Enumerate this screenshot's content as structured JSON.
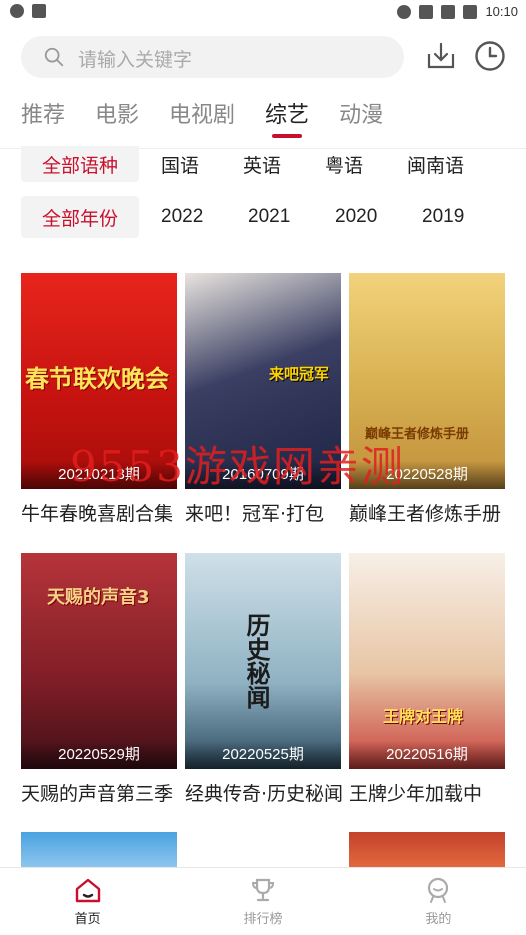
{
  "status_bar": {
    "time": "10:10"
  },
  "search": {
    "placeholder": "请输入关键字"
  },
  "tabs": [
    {
      "label": "推荐",
      "active": false
    },
    {
      "label": "电影",
      "active": false
    },
    {
      "label": "电视剧",
      "active": false
    },
    {
      "label": "综艺",
      "active": true
    },
    {
      "label": "动漫",
      "active": false
    }
  ],
  "filters": {
    "language": {
      "selected": "全部语种",
      "options": [
        "国语",
        "英语",
        "粤语",
        "闽南语"
      ]
    },
    "year": {
      "selected": "全部年份",
      "options": [
        "2022",
        "2021",
        "2020",
        "2019"
      ]
    }
  },
  "cards": [
    {
      "date": "20210213期",
      "title": "牛年春晚喜剧合集",
      "art": "春节联欢晚会"
    },
    {
      "date": "20160709期",
      "title": "来吧！冠军·打包",
      "art": "来吧冠军"
    },
    {
      "date": "20220528期",
      "title": "巅峰王者修炼手册",
      "art": "巅峰王者修炼手册"
    },
    {
      "date": "20220529期",
      "title": "天赐的声音第三季",
      "art": "天赐的声音3"
    },
    {
      "date": "20220525期",
      "title": "经典传奇·历史秘闻",
      "art": "历史秘闻"
    },
    {
      "date": "20220516期",
      "title": "王牌少年加载中",
      "art": "王牌对王牌"
    }
  ],
  "watermark": "9553游戏网亲测",
  "bottom_nav": [
    {
      "label": "首页",
      "icon": "home-icon",
      "active": true
    },
    {
      "label": "排行榜",
      "icon": "trophy-icon",
      "active": false
    },
    {
      "label": "我的",
      "icon": "profile-icon",
      "active": false
    }
  ],
  "colors": {
    "accent": "#c8102e",
    "chip_bg": "#f3f3f3",
    "search_bg": "#f2f2f2"
  }
}
